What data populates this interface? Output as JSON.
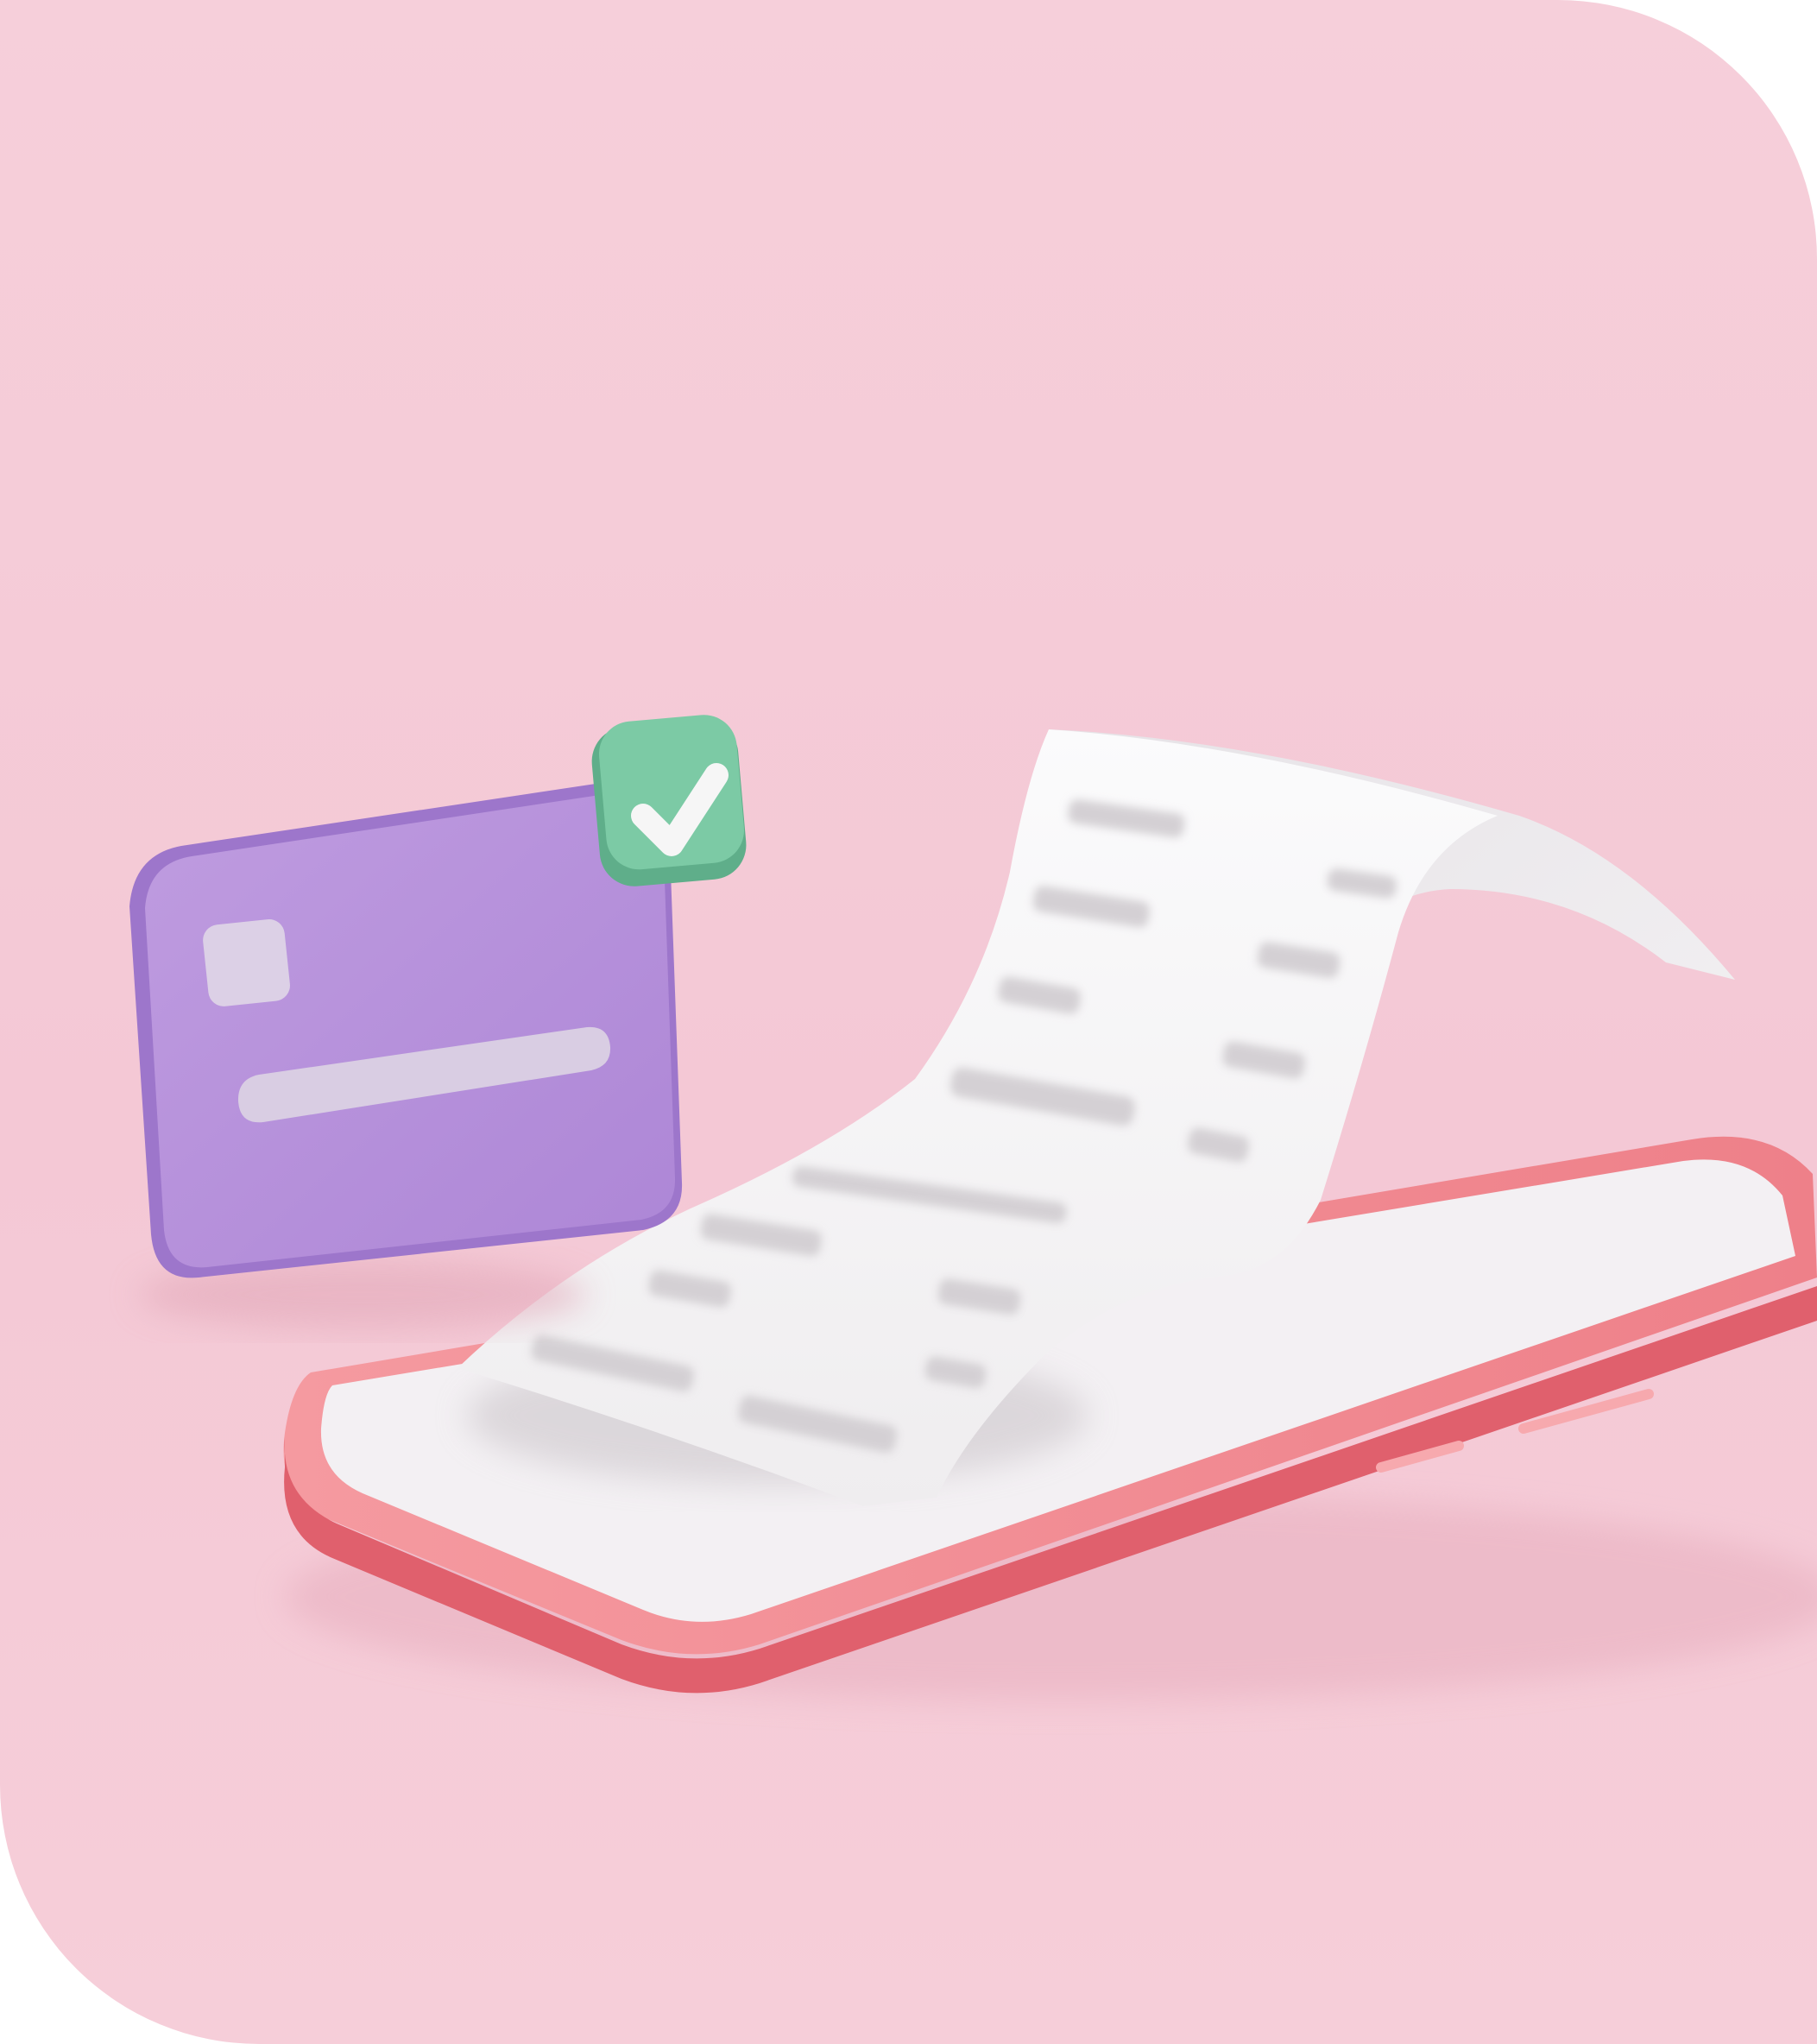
{
  "scene": {
    "description_tags": [
      "credit-card",
      "check-badge",
      "smartphone",
      "paper-receipt"
    ],
    "colors": {
      "background": "#f4c9d6",
      "background_light": "#f7d4de",
      "card": "#b892dc",
      "card_edge": "#9f78cc",
      "chip": "#dcd0e6",
      "stripe": "#d8cce2",
      "badge": "#7cc9a4",
      "badge_dark": "#5fb08b",
      "check": "#f4f4f4",
      "phone_body": "#f28c92",
      "phone_edge": "#e36c76",
      "phone_screen": "#f3f0f2",
      "receipt": "#f6f6f7",
      "receipt_shadow": "#dcd8dc",
      "receipt_text": "#d5d1d5"
    }
  }
}
